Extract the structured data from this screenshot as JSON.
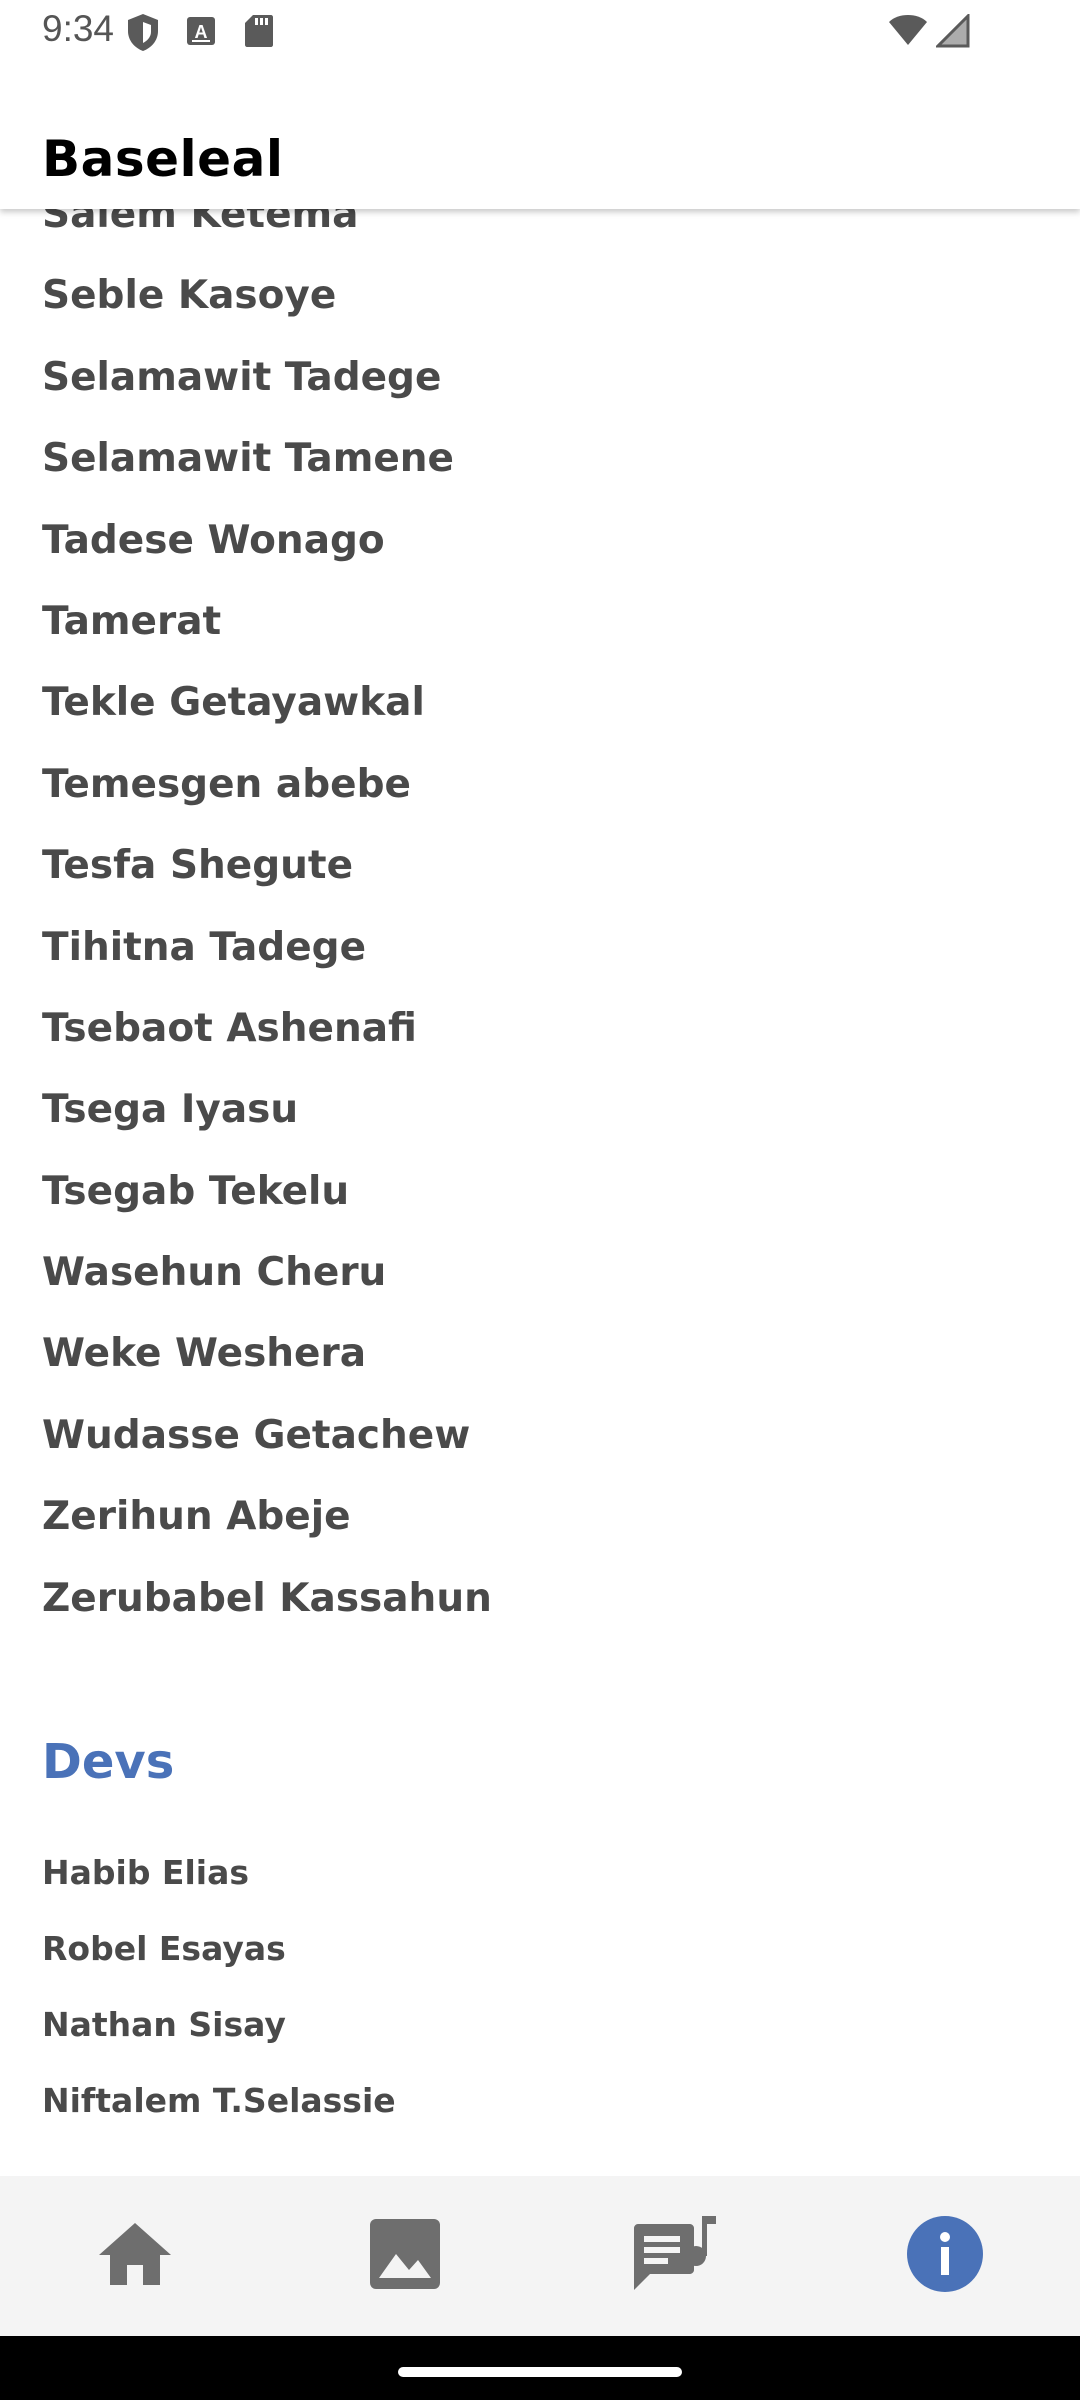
{
  "status_bar": {
    "time": "9:34",
    "icons": [
      "shield-icon",
      "keyboard-a-icon",
      "sd-card-icon",
      "wifi-icon",
      "signal-icon"
    ]
  },
  "app_bar": {
    "title": "Baseleal"
  },
  "names": [
    "Salem Ketema",
    "Seble Kasoye",
    "Selamawit Tadege",
    "Selamawit Tamene",
    "Tadese Wonago",
    "Tamerat",
    "Tekle Getayawkal",
    "Temesgen abebe",
    "Tesfa Shegute",
    "Tihitna Tadege",
    "Tsebaot Ashenafi",
    "Tsega Iyasu",
    "Tsegab Tekelu",
    "Wasehun Cheru",
    "Weke Weshera",
    "Wudasse Getachew",
    "Zerihun Abeje",
    "Zerubabel Kassahun"
  ],
  "devs_section": {
    "title": "Devs",
    "names": [
      "Habib Elias",
      "Robel Esayas",
      "Nathan Sisay",
      "Niftalem T.Selassie"
    ]
  },
  "bottom_nav": {
    "items": [
      {
        "icon": "home-icon",
        "active": false
      },
      {
        "icon": "image-icon",
        "active": false
      },
      {
        "icon": "lyrics-icon",
        "active": false
      },
      {
        "icon": "info-icon",
        "active": true
      }
    ],
    "active_color": "#4a72b8",
    "inactive_color": "#6e6e6e"
  },
  "colors": {
    "accent": "#4a72b8",
    "text": "#4a4a4a"
  }
}
